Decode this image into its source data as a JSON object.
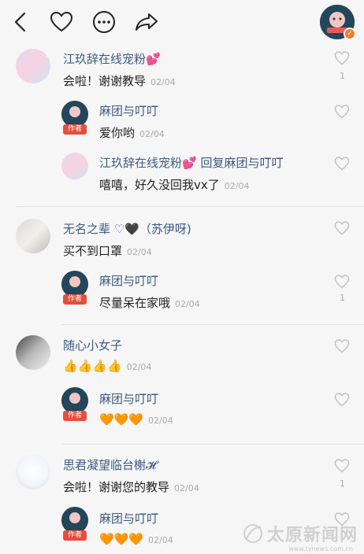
{
  "topbar": {
    "icons": [
      "back-icon",
      "heart-icon",
      "more-icon",
      "share-icon"
    ],
    "author_badge": "✓"
  },
  "comments": [
    {
      "name": "江玖辞在线宠粉💕",
      "text": "会啦！谢谢教导",
      "date": "02/04",
      "likes": "1",
      "replies": [
        {
          "name": "麻团与叮叮",
          "tag": "作者",
          "text": "爱你哟",
          "date": "02/04"
        },
        {
          "name": "江玖辞在线宠粉💕 回复麻团与叮叮",
          "text": "嘻嘻，好久没回我vx了",
          "date": "02/04"
        }
      ]
    },
    {
      "name": "无名之辈 ♡🖤（苏伊呀)",
      "text": "买不到口罩",
      "date": "02/04",
      "likes": "",
      "replies": [
        {
          "name": "麻团与叮叮",
          "tag": "作者",
          "text": "尽量呆在家哦",
          "date": "02/04",
          "likes": "1"
        }
      ]
    },
    {
      "name": "随心小女子",
      "text": "👍👍👍👍",
      "date": "02/04",
      "likes": "",
      "replies": [
        {
          "name": "麻团与叮叮",
          "tag": "作者",
          "text": "🧡🧡🧡",
          "date": "02/04"
        }
      ]
    },
    {
      "name": "思君凝望临台榭𝓗",
      "text": "会啦！谢谢您的教导",
      "date": "02/04",
      "likes": "1",
      "replies": [
        {
          "name": "麻团与叮叮",
          "tag": "作者",
          "text": "🧡🧡🧡",
          "date": "02/04"
        }
      ]
    }
  ],
  "watermark": {
    "text": "太原新闻网",
    "url": "www.tynews.com.cn"
  },
  "colors": {
    "name": "#3c5a84",
    "author_tag": "#e84c3d",
    "badge": "#f07d2b"
  }
}
